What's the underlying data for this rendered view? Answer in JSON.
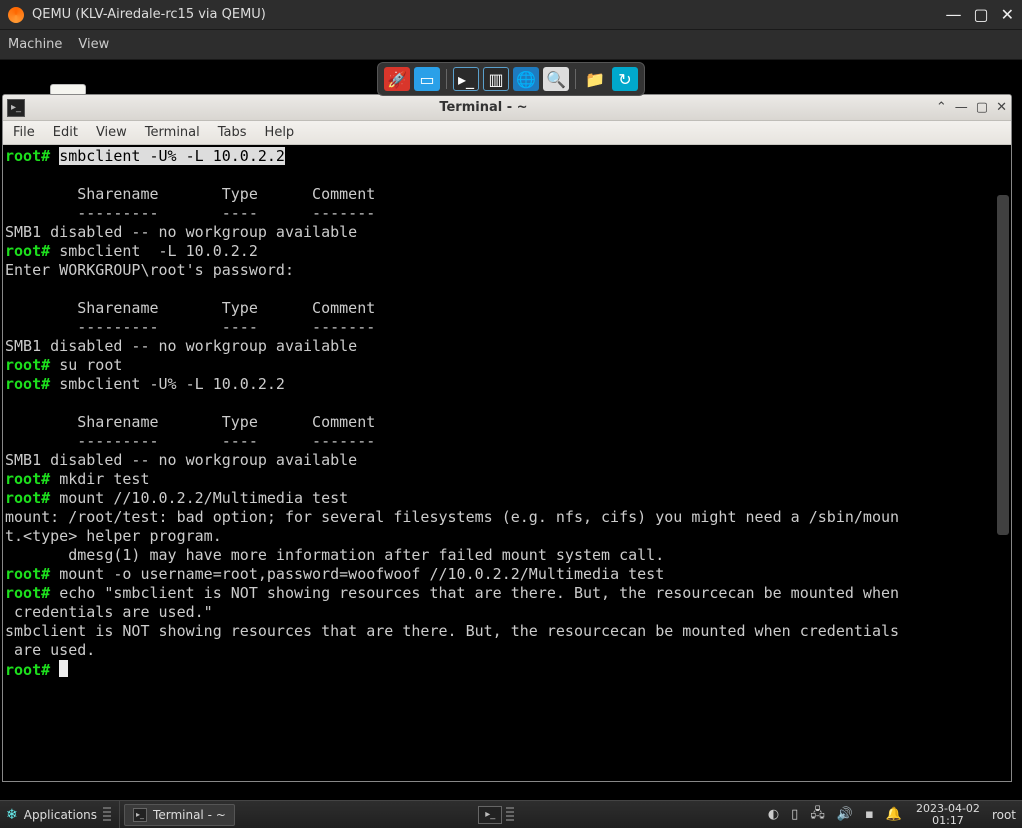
{
  "qemu": {
    "title": "QEMU (KLV-Airedale-rc15 via QEMU)",
    "menu": {
      "machine": "Machine",
      "view": "View"
    }
  },
  "terminal": {
    "title": "Terminal - ~",
    "menu": {
      "file": "File",
      "edit": "Edit",
      "view": "View",
      "terminal": "Terminal",
      "tabs": "Tabs",
      "help": "Help"
    },
    "prompt": "root#",
    "lines": {
      "cmd1": "smbclient -U% -L 10.0.2.2",
      "hdr": "        Sharename       Type      Comment",
      "sep": "        ---------       ----      -------",
      "smb1": "SMB1 disabled -- no workgroup available",
      "cmd2": "smbclient  -L 10.0.2.2",
      "pw": "Enter WORKGROUP\\root's password:",
      "cmd3": "su root",
      "cmd4": "smbclient -U% -L 10.0.2.2",
      "cmd5": "mkdir test",
      "cmd6": "mount //10.0.2.2/Multimedia test",
      "merr1": "mount: /root/test: bad option; for several filesystems (e.g. nfs, cifs) you might need a /sbin/moun",
      "merr2": "t.<type> helper program.",
      "merr3": "       dmesg(1) may have more information after failed mount system call.",
      "cmd7": "mount -o username=root,password=woofwoof //10.0.2.2/Multimedia test",
      "cmd8": "echo \"smbclient is NOT showing resources that are there. But, the resourcecan be mounted when",
      "cmd8b": " credentials are used.\"",
      "echo1": "smbclient is NOT showing resources that are there. But, the resourcecan be mounted when credentials",
      "echo2": " are used."
    }
  },
  "panel": {
    "apps": "Applications",
    "task": "Terminal - ~",
    "date": "2023-04-02",
    "time": "01:17",
    "user": "root"
  }
}
